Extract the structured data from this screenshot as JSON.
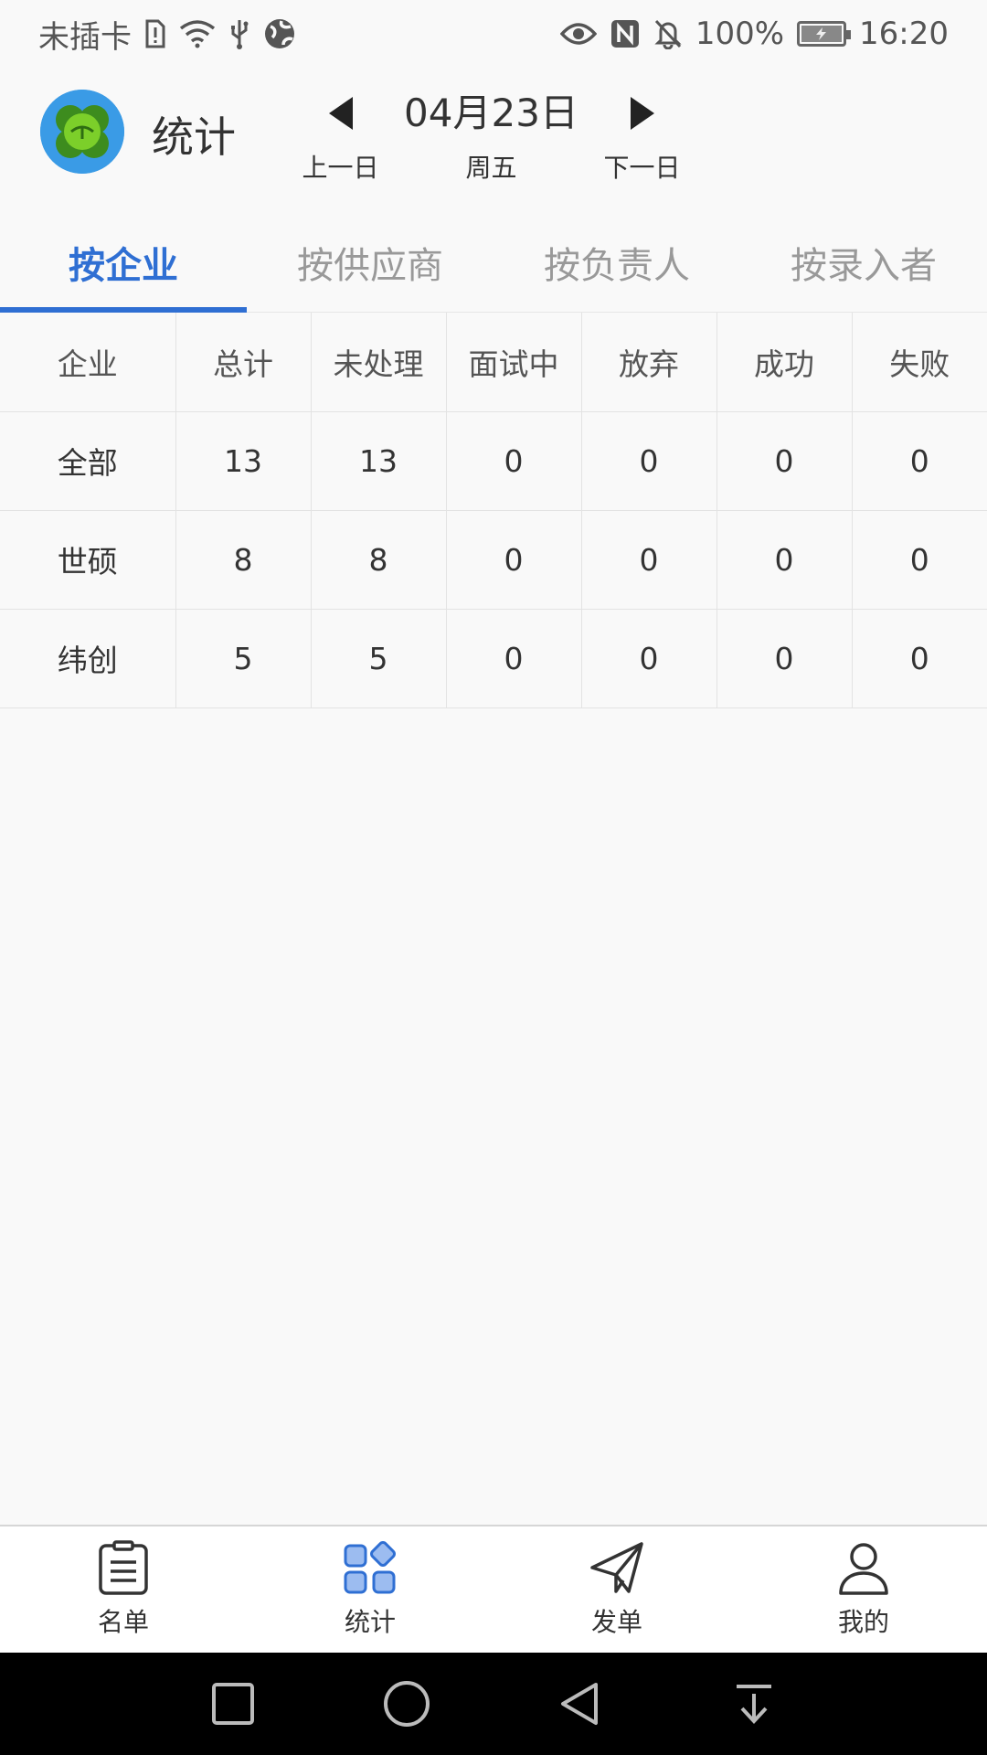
{
  "status_bar": {
    "carrier": "未插卡",
    "battery": "100%",
    "time": "16:20",
    "battery_level": 1.0
  },
  "header": {
    "title": "统计",
    "date": "04月23日",
    "weekday": "周五",
    "prev_label": "上一日",
    "next_label": "下一日"
  },
  "tabs": [
    {
      "label": "按企业",
      "active": true
    },
    {
      "label": "按供应商",
      "active": false
    },
    {
      "label": "按负责人",
      "active": false
    },
    {
      "label": "按录入者",
      "active": false
    }
  ],
  "table": {
    "headers": [
      "企业",
      "总计",
      "未处理",
      "面试中",
      "放弃",
      "成功",
      "失败"
    ],
    "rows": [
      [
        "全部",
        "13",
        "13",
        "0",
        "0",
        "0",
        "0"
      ],
      [
        "世硕",
        "8",
        "8",
        "0",
        "0",
        "0",
        "0"
      ],
      [
        "纬创",
        "5",
        "5",
        "0",
        "0",
        "0",
        "0"
      ]
    ]
  },
  "bottom_nav": [
    {
      "label": "名单",
      "icon": "clipboard-list-icon"
    },
    {
      "label": "统计",
      "icon": "grid-apps-icon",
      "active": true
    },
    {
      "label": "发单",
      "icon": "paper-plane-icon"
    },
    {
      "label": "我的",
      "icon": "user-icon"
    }
  ],
  "colors": {
    "accent": "#2f6fd3",
    "background": "#f9f9f9"
  }
}
